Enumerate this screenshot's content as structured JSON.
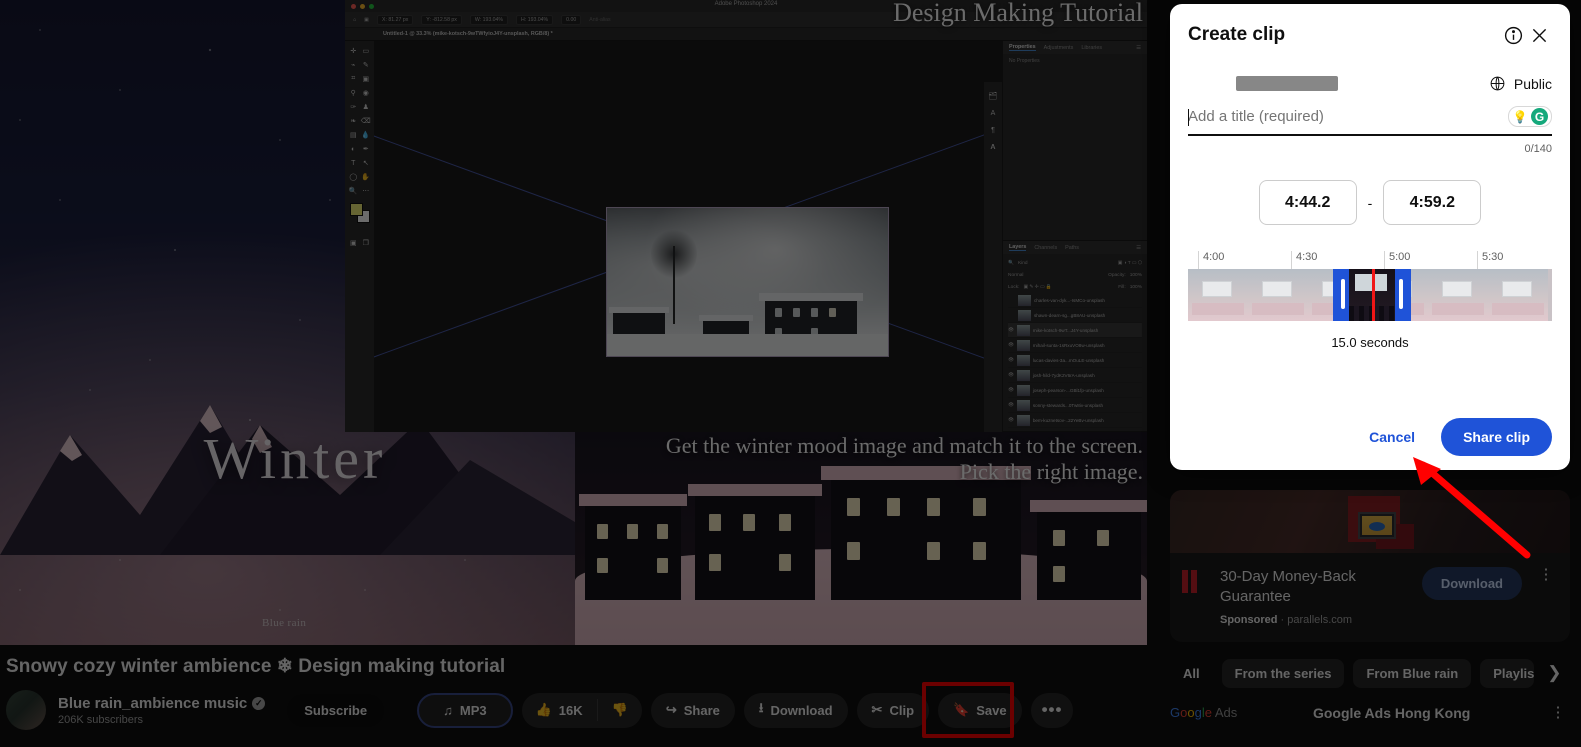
{
  "modal": {
    "title": "Create clip",
    "info_icon": "info-icon",
    "close_icon": "close-icon",
    "visibility": {
      "label": "Public",
      "icon": "globe-icon"
    },
    "title_input": {
      "placeholder": "Add a title (required)",
      "value": ""
    },
    "grammarly": {
      "bulb_icon": "lightbulb-icon",
      "g_icon": "grammarly-g-icon"
    },
    "char_counter": "0/140",
    "start_time": "4:44.2",
    "time_separator": "-",
    "end_time": "4:59.2",
    "timeline_ticks": [
      "4:00",
      "4:30",
      "5:00",
      "5:30"
    ],
    "duration": "15.0 seconds",
    "cancel_label": "Cancel",
    "share_label": "Share clip",
    "accent_color": "#1f53d8",
    "playhead_color": "#f01616"
  },
  "video": {
    "overlay_title": "Design Making Tutorial",
    "caption_line1": "Get the winter mood image and match it to the screen.",
    "caption_line2": "Pick the right image.",
    "winter_word": "Winter",
    "watermark": "Blue rain"
  },
  "photoshop": {
    "app_title": "Adobe Photoshop 2024",
    "document_tab": "Untitled-1 @ 33.3% (mike-kotsch-9wTWfyioJ4Y-unsplash, RGB/8) *",
    "options": [
      {
        "label": "X:",
        "value": "81.27 px"
      },
      {
        "label": "Y:",
        "value": "-812.58 px"
      },
      {
        "label": "W:",
        "value": "193.04%"
      },
      {
        "label": "H:",
        "value": "193.04%"
      },
      {
        "label": "",
        "value": "0.00"
      }
    ],
    "anti_alias": "Anti-alias",
    "properties_panel": {
      "tabs": [
        "Properties",
        "Adjustments",
        "Libraries"
      ],
      "empty_text": "No Properties"
    },
    "layers_panel": {
      "tabs": [
        "Layers",
        "Channels",
        "Paths"
      ],
      "search_placeholder": "Kind",
      "blend_mode": "Normal",
      "opacity_label": "Opacity:",
      "opacity_value": "100%",
      "lock_label": "Lock:",
      "fill_label": "Fill:",
      "fill_value": "100%",
      "layers": [
        "charles-van-dyk...-IsMCo-unsplash",
        "shawn-dearn-sg...gB8AU-unsplash",
        "mike-kotsch-9wT...J4Y-unsplash",
        "mihail-sunta-1sRxuVO8w-unsplash",
        "lucas-davies-3a...mOuLE-unsplash",
        "josh-hild-7ydK2V6rA-unsplash",
        "joseph-pearson-...GBl1fp-unsplash",
        "sonny-stewards...0Tw8iv-unsplash",
        "bem-kuznetsov-..22YeBv-unsplash"
      ]
    }
  },
  "meta": {
    "video_title": "Snowy cozy winter ambience ❄ Design making tutorial",
    "channel_name": "Blue rain_ambience music",
    "verified_icon": "verified-badge-icon",
    "subscriber_count": "206K subscribers",
    "subscribe_label": "Subscribe",
    "actions": [
      {
        "name": "mp3",
        "label": "MP3",
        "icon": "music-note-icon"
      },
      {
        "name": "like",
        "label": "16K",
        "icon": "thumb-up-icon"
      },
      {
        "name": "dislike",
        "label": "",
        "icon": "thumb-down-icon"
      },
      {
        "name": "share",
        "label": "Share",
        "icon": "share-arrow-icon"
      },
      {
        "name": "download",
        "label": "Download",
        "icon": "download-icon"
      },
      {
        "name": "clip",
        "label": "Clip",
        "icon": "scissors-icon"
      },
      {
        "name": "save",
        "label": "Save",
        "icon": "bookmark-icon"
      },
      {
        "name": "more",
        "label": "•••",
        "icon": "more-horizontal-icon"
      }
    ],
    "highlight_color": "#ff0000"
  },
  "rail": {
    "ad": {
      "title": "30-Day Money-Back Guarantee",
      "sponsored_label": "Sponsored",
      "separator": "·",
      "domain": "parallels.com",
      "cta_label": "Download",
      "kebab_icon": "more-vertical-icon"
    },
    "chips": [
      "All",
      "From the series",
      "From Blue rain",
      "Playlist"
    ],
    "chip_next_icon": "chevron-right-icon",
    "google_ads_logo": "Google Ads",
    "google_ads_title": "Google Ads Hong Kong",
    "google_ads_kebab": "more-vertical-icon"
  }
}
